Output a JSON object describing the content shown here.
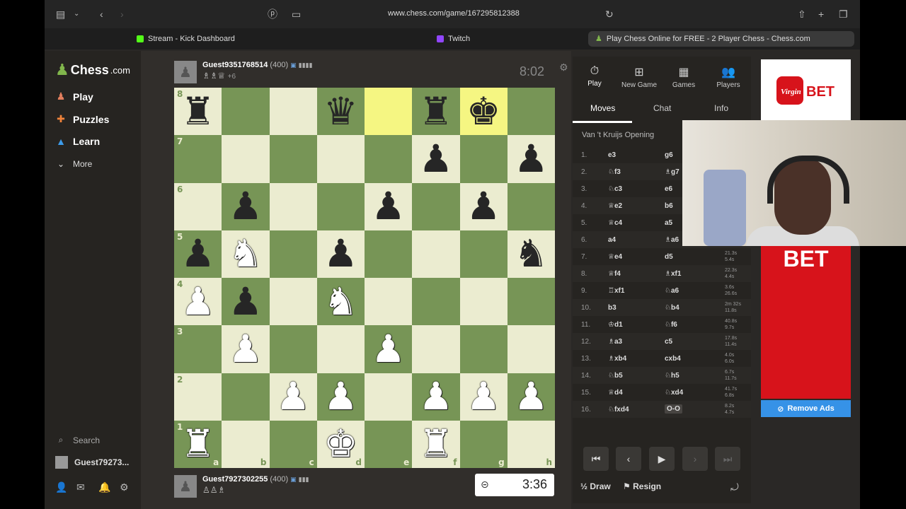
{
  "browser": {
    "url": "www.chess.com/game/167295812388",
    "tabs": [
      {
        "label": "Stream - Kick Dashboard",
        "color": "#53fc18"
      },
      {
        "label": "Twitch",
        "color": "#9146ff"
      },
      {
        "label": "Play Chess Online for FREE - 2 Player Chess - Chess.com",
        "color": "#81b64c"
      }
    ]
  },
  "sidebar": {
    "logo": "Chess",
    "logo_suffix": ".com",
    "items": [
      {
        "label": "Play",
        "icon": "pawn-play-icon",
        "glyph": "♟"
      },
      {
        "label": "Puzzles",
        "icon": "puzzle-icon",
        "glyph": "✚"
      },
      {
        "label": "Learn",
        "icon": "grad-cap-icon",
        "glyph": "🎓"
      },
      {
        "label": "More",
        "icon": "chevron-down-icon",
        "glyph": "⌄"
      }
    ],
    "search_label": "Search",
    "user_label": "Guest79273..."
  },
  "opponent": {
    "name": "Guest9351768514",
    "rating": "(400)",
    "captured": "♗♗♕",
    "advantage": "+6",
    "clock": "8:02"
  },
  "player": {
    "name": "Guest7927302255",
    "rating": "(400)",
    "captured": "♙♙♗",
    "clock": "3:36"
  },
  "board": {
    "ranks": [
      "8",
      "7",
      "6",
      "5",
      "4",
      "3",
      "2",
      "1"
    ],
    "files": [
      "a",
      "b",
      "c",
      "d",
      "e",
      "f",
      "g",
      "h"
    ],
    "position": [
      [
        "bR",
        "",
        "",
        "bQ",
        "",
        "bR",
        "bK",
        ""
      ],
      [
        "",
        "",
        "",
        "",
        "",
        "bP",
        "",
        "bP"
      ],
      [
        "",
        "bP",
        "",
        "",
        "bP",
        "",
        "bP",
        ""
      ],
      [
        "bP",
        "wN",
        "",
        "bP",
        "",
        "",
        "",
        "bN"
      ],
      [
        "wP",
        "bP",
        "",
        "wN",
        "",
        "",
        "",
        ""
      ],
      [
        "",
        "wP",
        "",
        "",
        "wP",
        "",
        "",
        ""
      ],
      [
        "",
        "",
        "wP",
        "wP",
        "",
        "wP",
        "wP",
        "wP"
      ],
      [
        "wR",
        "",
        "",
        "wK",
        "",
        "wR",
        "",
        ""
      ]
    ],
    "highlight": [
      [
        0,
        4
      ],
      [
        0,
        6
      ]
    ]
  },
  "panel": {
    "top_tabs": [
      {
        "label": "Play",
        "glyph": "⏱",
        "icon": "stopwatch-icon"
      },
      {
        "label": "New Game",
        "glyph": "⊞",
        "icon": "plus-square-icon"
      },
      {
        "label": "Games",
        "glyph": "▦",
        "icon": "board-icon"
      },
      {
        "label": "Players",
        "glyph": "👥",
        "icon": "players-icon"
      }
    ],
    "sub_tabs": [
      "Moves",
      "Chat",
      "Info"
    ],
    "opening": "Van 't Kruijs Opening",
    "moves": [
      {
        "n": "1.",
        "w": "e3",
        "b": "g6",
        "t": ""
      },
      {
        "n": "2.",
        "w": "♘f3",
        "b": "♗g7",
        "t": ""
      },
      {
        "n": "3.",
        "w": "♘c3",
        "b": "e6",
        "t": ""
      },
      {
        "n": "4.",
        "w": "♕e2",
        "b": "b6",
        "t": ""
      },
      {
        "n": "5.",
        "w": "♕c4",
        "b": "a5",
        "t": ""
      },
      {
        "n": "6.",
        "w": "a4",
        "b": "♗a6",
        "t": ""
      },
      {
        "n": "7.",
        "w": "♕e4",
        "b": "d5",
        "t": "21.3s|5.4s"
      },
      {
        "n": "8.",
        "w": "♕f4",
        "b": "♗xf1",
        "t": "22.3s|4.4s"
      },
      {
        "n": "9.",
        "w": "♖xf1",
        "b": "♘a6",
        "t": "3.6s|26.6s"
      },
      {
        "n": "10.",
        "w": "b3",
        "b": "♘b4",
        "t": "2m 32s|11.8s"
      },
      {
        "n": "11.",
        "w": "♔d1",
        "b": "♘f6",
        "t": "40.8s|9.7s"
      },
      {
        "n": "12.",
        "w": "♗a3",
        "b": "c5",
        "t": "17.8s|11.4s"
      },
      {
        "n": "13.",
        "w": "♗xb4",
        "b": "cxb4",
        "t": "4.0s|6.0s"
      },
      {
        "n": "14.",
        "w": "♘b5",
        "b": "♘h5",
        "t": "6.7s|11.7s"
      },
      {
        "n": "15.",
        "w": "♕d4",
        "b": "♘xd4",
        "t": "41.7s|6.8s"
      },
      {
        "n": "16.",
        "w": "♘fxd4",
        "b": "O-O",
        "t": "8.2s|4.7s"
      }
    ],
    "draw_label": "Draw",
    "draw_prefix": "½",
    "resign_label": "Resign"
  },
  "ad": {
    "brand": "Virgin BET",
    "tagline": "BET",
    "remove_label": "Remove Ads"
  }
}
